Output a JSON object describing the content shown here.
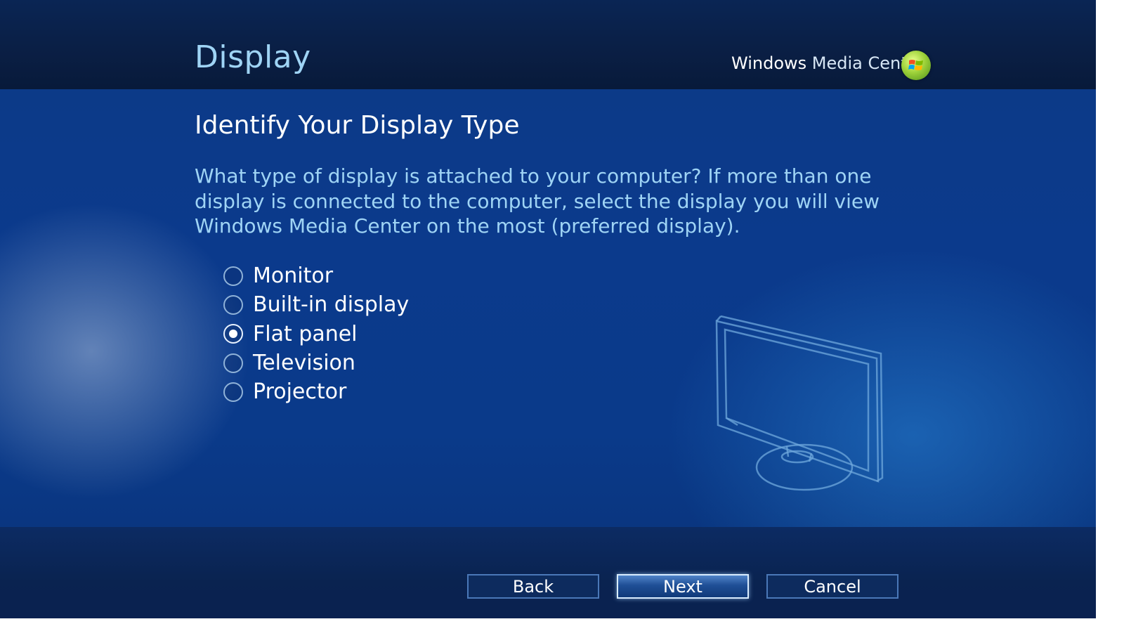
{
  "header": {
    "title": "Display",
    "brand_bold": "Windows",
    "brand_light": "Media Center",
    "logo_icon": "windows-flag-icon"
  },
  "main": {
    "heading": "Identify Your Display Type",
    "question": "What type of display is attached to your computer? If more than one display is connected to the computer, select the display you will view Windows Media Center on the most (preferred display).",
    "options": [
      {
        "label": "Monitor",
        "selected": false
      },
      {
        "label": "Built-in display",
        "selected": false
      },
      {
        "label": "Flat panel",
        "selected": true
      },
      {
        "label": "Television",
        "selected": false
      },
      {
        "label": "Projector",
        "selected": false
      }
    ],
    "illustration_icon": "monitor-icon"
  },
  "footer": {
    "back_label": "Back",
    "next_label": "Next",
    "cancel_label": "Cancel"
  },
  "colors": {
    "title_text": "#9fd4f5",
    "heading_text": "#ffffff",
    "background": "#0b3a8c",
    "header_band": "#0a1f45"
  }
}
